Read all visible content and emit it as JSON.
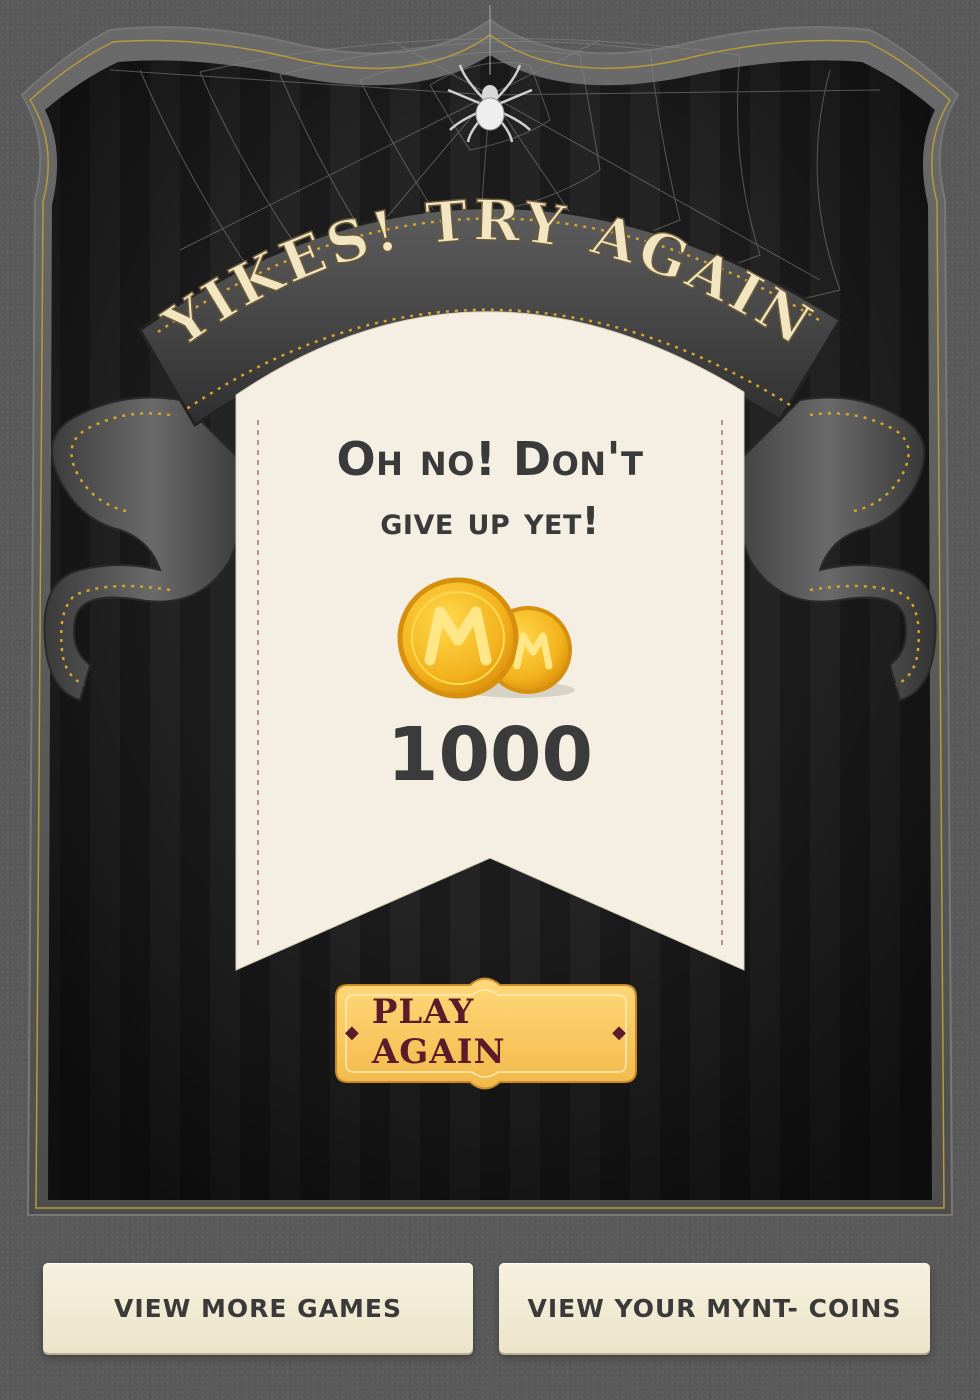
{
  "banner": {
    "title": "YIKES! TRY AGAIN"
  },
  "card": {
    "message_line1": "Oh no! Don't",
    "message_line2": "give up yet!",
    "coin_icon": "mynt-coin-icon",
    "coin_amount": "1000"
  },
  "play_button": {
    "label": "PLAY AGAIN"
  },
  "footer": {
    "more_games_label": "VIEW MORE GAMES",
    "coins_label": "VIEW YOUR MYNT- COINS"
  },
  "colors": {
    "frame_dark": "#1c1c1c",
    "ribbon": "#4a4a4a",
    "gold_dots": "#d8a42a",
    "banner_text": "#f2e6c2",
    "card": "#f4efe2",
    "coin": "#f3b21d",
    "button_gold": "#f6c65a",
    "button_text": "#5b1b2a"
  }
}
